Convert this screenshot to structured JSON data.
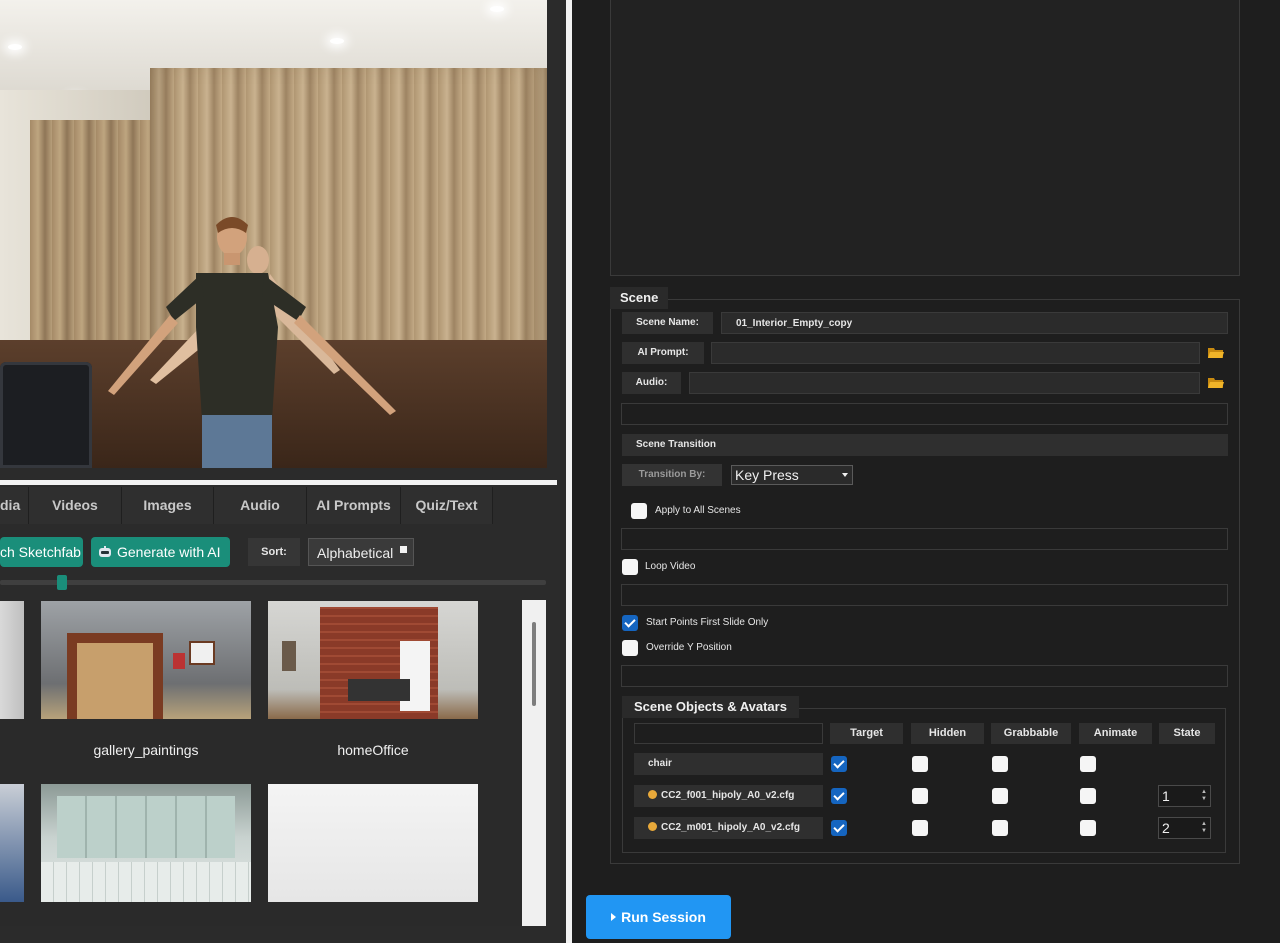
{
  "media_tabs": [
    {
      "label": "dia"
    },
    {
      "label": "Videos"
    },
    {
      "label": "Images"
    },
    {
      "label": "Audio"
    },
    {
      "label": "AI Prompts"
    },
    {
      "label": "Quiz/Text"
    }
  ],
  "toolbar": {
    "sketchfab_label": "ch Sketchfab",
    "generate_ai_label": "Generate with AI",
    "sort_label": "Sort:",
    "sort_value": "Alphabetical"
  },
  "zoom": {
    "value": 0.12
  },
  "scene_grid": [
    {
      "name": ""
    },
    {
      "name": "gallery_paintings"
    },
    {
      "name": "homeOffice"
    },
    {
      "name": ""
    },
    {
      "name": ""
    },
    {
      "name": ""
    }
  ],
  "scene": {
    "legend": "Scene",
    "name_label": "Scene Name:",
    "name_value": "01_Interior_Empty_copy",
    "ai_prompt_label": "AI Prompt:",
    "ai_prompt_value": "",
    "audio_label": "Audio:",
    "audio_value": "",
    "transition_header": "Scene Transition",
    "transition_by_label": "Transition By:",
    "transition_by_value": "Key Press",
    "apply_all_label": "Apply to All Scenes",
    "apply_all_checked": false,
    "loop_video_label": "Loop Video",
    "loop_video_checked": false,
    "start_points_label": "Start Points First Slide Only",
    "start_points_checked": true,
    "override_y_label": "Override Y Position",
    "override_y_checked": false
  },
  "objects": {
    "legend": "Scene Objects & Avatars",
    "columns": [
      "Target",
      "Hidden",
      "Grabbable",
      "Animate",
      "State"
    ],
    "rows": [
      {
        "name": "chair",
        "avatar": false,
        "target": true,
        "hidden": false,
        "grabbable": false,
        "animate": false,
        "state": ""
      },
      {
        "name": "CC2_f001_hipoly_A0_v2.cfg",
        "avatar": true,
        "target": true,
        "hidden": false,
        "grabbable": false,
        "animate": false,
        "state": "1"
      },
      {
        "name": "CC2_m001_hipoly_A0_v2.cfg",
        "avatar": true,
        "target": true,
        "hidden": false,
        "grabbable": false,
        "animate": false,
        "state": "2"
      }
    ]
  },
  "run_session_label": "Run Session",
  "colors": {
    "teal": "#1a8e7a",
    "primary_blue": "#2196f3",
    "checkbox_blue": "#1565c0",
    "folder_icon": "#f0b429"
  }
}
